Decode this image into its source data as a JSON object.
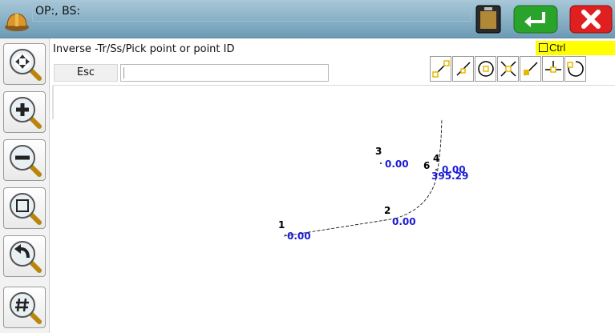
{
  "titlebar": {
    "title": "OP:, BS:",
    "icons": {
      "app": "hard-hat-icon",
      "keyboard": "keyboard-icon",
      "enter": "enter-icon",
      "close": "close-icon"
    },
    "colors": {
      "enter": "#2aa32a",
      "close": "#e02020"
    }
  },
  "toolbar": {
    "tools": [
      {
        "name": "zoom-extents",
        "icon": "zoom-extents-icon"
      },
      {
        "name": "zoom-in",
        "icon": "zoom-in-icon"
      },
      {
        "name": "zoom-out",
        "icon": "zoom-out-icon"
      },
      {
        "name": "zoom-window",
        "icon": "zoom-window-icon"
      },
      {
        "name": "zoom-previous",
        "icon": "zoom-previous-icon"
      },
      {
        "name": "zoom-points",
        "icon": "zoom-grid-icon"
      }
    ]
  },
  "command": {
    "prompt": "Inverse -Tr/Ss/Pick point or point ID",
    "esc_label": "Esc",
    "input_value": ""
  },
  "ctrl": {
    "label": "Ctrl",
    "checked": false
  },
  "snap_modes": [
    "endpoint",
    "nearest",
    "center",
    "intersection",
    "perpendicular",
    "tangent",
    "circle"
  ],
  "points": [
    {
      "id": "1",
      "elev": "0.00"
    },
    {
      "id": "2",
      "elev": "0.00"
    },
    {
      "id": "3",
      "elev": "0.00"
    },
    {
      "id": "4",
      "elev": "0.00"
    },
    {
      "id": "6",
      "elev": "395.29"
    }
  ],
  "colors": {
    "titlebar": "#87b0c6",
    "ctrl_bg": "#ffff00",
    "elevation_text": "#1a1ad6",
    "snap_icon": "#e6b800"
  }
}
